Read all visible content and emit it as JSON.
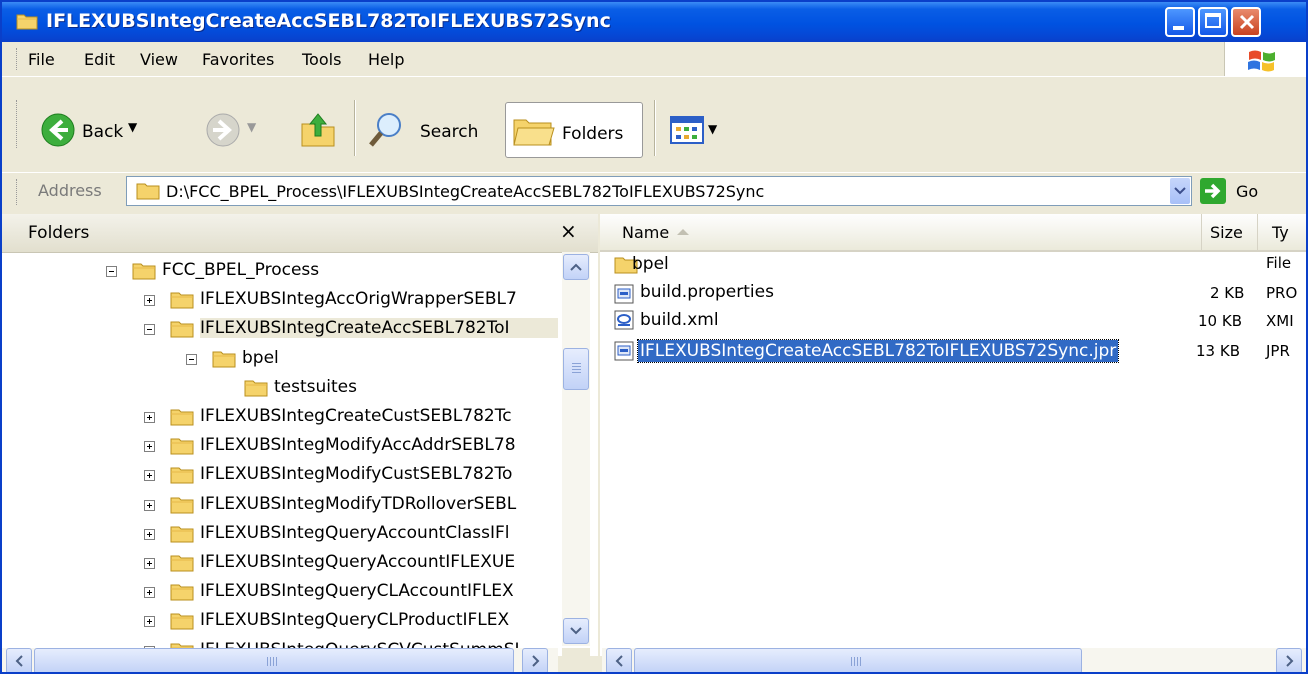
{
  "window": {
    "title": "IFLEXUBSIntegCreateAccSEBL782ToIFLEXUBS72Sync"
  },
  "menu": {
    "items": [
      {
        "label": "File"
      },
      {
        "label": "Edit"
      },
      {
        "label": "View"
      },
      {
        "label": "Favorites"
      },
      {
        "label": "Tools"
      },
      {
        "label": "Help"
      }
    ]
  },
  "toolbar": {
    "back_label": "Back",
    "search_label": "Search",
    "folders_label": "Folders"
  },
  "address": {
    "label": "Address",
    "path": "D:\\FCC_BPEL_Process\\IFLEXUBSIntegCreateAccSEBL782ToIFLEXUBS72Sync",
    "go_label": "Go"
  },
  "folders_pane": {
    "title": "Folders",
    "close_glyph": "×",
    "tree": [
      {
        "label": "FCC_BPEL_Process",
        "expander": "minus"
      },
      {
        "label": "IFLEXUBSIntegAccOrigWrapperSEBL7",
        "expander": "plus"
      },
      {
        "label": "IFLEXUBSIntegCreateAccSEBL782ToI",
        "expander": "minus"
      },
      {
        "label": "bpel",
        "expander": "minus"
      },
      {
        "label": "testsuites",
        "expander": "none"
      },
      {
        "label": "IFLEXUBSIntegCreateCustSEBL782Tc",
        "expander": "plus"
      },
      {
        "label": "IFLEXUBSIntegModifyAccAddrSEBL78",
        "expander": "plus"
      },
      {
        "label": "IFLEXUBSIntegModifyCustSEBL782To",
        "expander": "plus"
      },
      {
        "label": "IFLEXUBSIntegModifyTDRolloverSEBL",
        "expander": "plus"
      },
      {
        "label": "IFLEXUBSIntegQueryAccountClassIFl",
        "expander": "plus"
      },
      {
        "label": "IFLEXUBSIntegQueryAccountIFLEXUE",
        "expander": "plus"
      },
      {
        "label": "IFLEXUBSIntegQueryCLAccountIFLEX",
        "expander": "plus"
      },
      {
        "label": "IFLEXUBSIntegQueryCLProductIFLEX",
        "expander": "plus"
      },
      {
        "label": "IFLEXUBSIntegQuerySCVCustSummSI",
        "expander": "plus"
      }
    ]
  },
  "file_list": {
    "columns": [
      "Name",
      "Size",
      "Ty"
    ],
    "rows": [
      {
        "name": "bpel",
        "size": "",
        "type": "File",
        "icon": "folder-icon"
      },
      {
        "name": "build.properties",
        "size": "2 KB",
        "type": "PRO",
        "icon": "properties-file-icon"
      },
      {
        "name": "build.xml",
        "size": "10 KB",
        "type": "XMI",
        "icon": "xml-file-icon"
      },
      {
        "name": "IFLEXUBSIntegCreateAccSEBL782ToIFLEXUBS72Sync.jpr",
        "size": "13 KB",
        "type": "JPR",
        "icon": "jpr-file-icon",
        "selected": true
      }
    ]
  },
  "colors": {
    "titlebar": "#0052e1",
    "chrome": "#ece9d8",
    "selection": "#316ac5",
    "folder": "#f5d36b"
  }
}
